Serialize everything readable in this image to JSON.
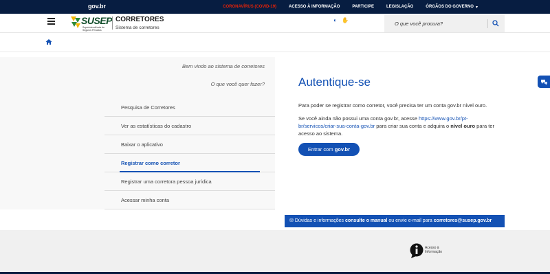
{
  "govbar": {
    "logo": "gov.br",
    "links": [
      "CORONAVÍRUS (COVID-19)",
      "ACESSO À INFORMAÇÃO",
      "PARTICIPE",
      "LEGISLAÇÃO",
      "ÓRGÃOS DO GOVERNO"
    ],
    "alert_color": "#e52207",
    "bg": "#071d41"
  },
  "header": {
    "logo_word": "SUSEP",
    "logo_sub": "Superintendência de Seguros Privados",
    "title": "CORRETORES",
    "subtitle": "Sistema de corretores",
    "search_placeholder": "O que você procura?",
    "tools": [
      "contrast-icon",
      "vlibras-icon"
    ]
  },
  "sidebar": {
    "welcome": "Bem vindo ao sistema de corretores",
    "question": "O que você quer fazer?",
    "items": [
      {
        "label": "Pesquisa de Corretores",
        "active": false
      },
      {
        "label": "Ver as estatísticas do cadastro",
        "active": false
      },
      {
        "label": "Baixar o aplicativo",
        "active": false
      },
      {
        "label": "Registrar como corretor",
        "active": true
      },
      {
        "label": "Registrar uma corretora pessoa jurídica",
        "active": false
      },
      {
        "label": "Acessar minha conta",
        "active": false
      }
    ]
  },
  "main": {
    "title": "Autentique-se",
    "para1": "Para poder se registrar como corretor, você precisa ter um conta gov.br nível ouro.",
    "para2_a": "Se você ainda não possui uma conta gov.br, acesse ",
    "para2_link": "https://www.gov.br/pt-br/servicos/criar-sua-conta-gov.br",
    "para2_b": " para criar sua conta e adquira o ",
    "para2_bold": "nível ouro",
    "para2_c": " para ter acesso ao sistema.",
    "button_prefix": "Entrar com ",
    "button_bold": "gov.br"
  },
  "help": {
    "prefix": "Dúvidas e informações ",
    "manual": "consulte o manual",
    "middle": " ou envie e-mail para ",
    "email": "corretores@susep.gov.br"
  },
  "footer": {
    "access_line1": "Acesso à",
    "access_line2": "Informação"
  },
  "colors": {
    "primary": "#1351b4",
    "brand_green": "#0e4b28",
    "dark_navy": "#071d41"
  }
}
